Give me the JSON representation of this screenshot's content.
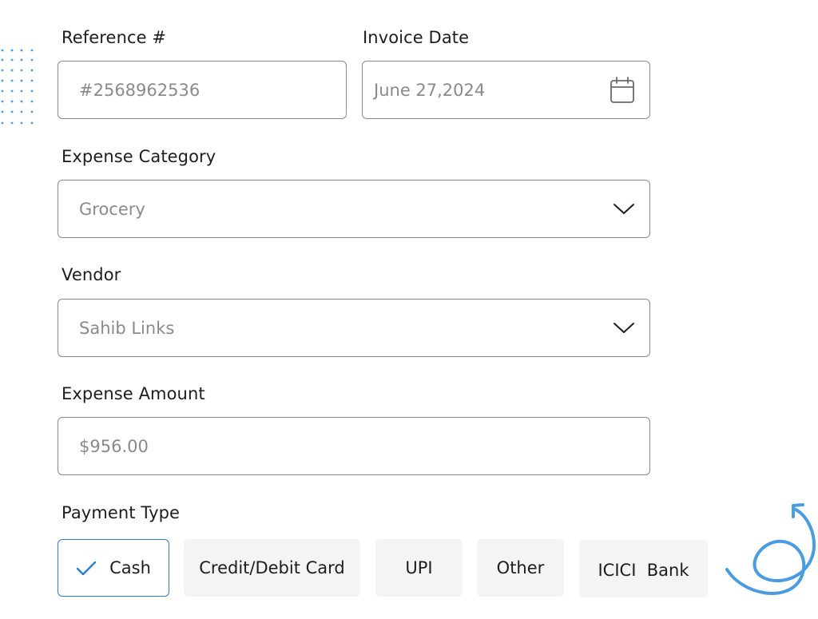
{
  "form": {
    "reference": {
      "label": "Reference #",
      "value": "#2568962536"
    },
    "invoice_date": {
      "label": "Invoice Date",
      "value": "June 27,2024",
      "icon": "calendar-icon"
    },
    "expense_category": {
      "label": "Expense Category",
      "value": "Grocery",
      "icon": "chevron-down-icon"
    },
    "vendor": {
      "label": "Vendor",
      "value": "Sahib Links",
      "icon": "chevron-down-icon"
    },
    "expense_amount": {
      "label": "Expense Amount",
      "value": "$956.00"
    },
    "payment_type": {
      "label": "Payment Type",
      "options": [
        {
          "label": "Cash",
          "selected": true
        },
        {
          "label": "Credit/Debit Card",
          "selected": false
        },
        {
          "label": "UPI",
          "selected": false
        },
        {
          "label": "Other",
          "selected": false
        },
        {
          "label": "ICICI  Bank",
          "selected": false
        }
      ]
    }
  },
  "colors": {
    "accent": "#2f7cc9",
    "border": "#8a8a8a",
    "placeholder": "#8a8a8a",
    "chip_bg": "#f4f4f4",
    "decor": "#4a9be0"
  }
}
